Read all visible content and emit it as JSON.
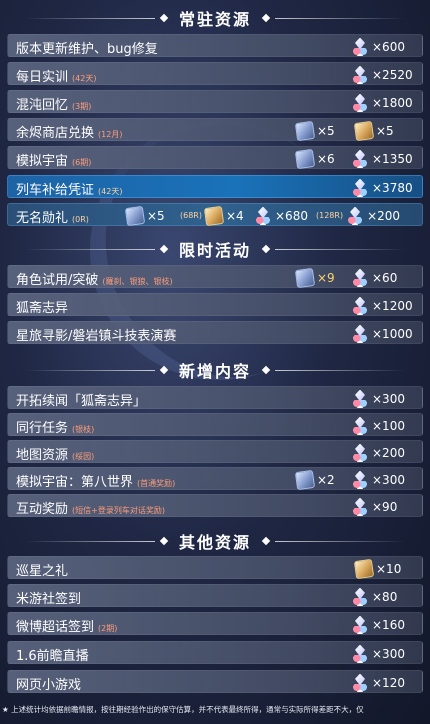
{
  "sections": {
    "permanent": "常驻资源",
    "limited": "限时活动",
    "new": "新增内容",
    "other": "其他资源"
  },
  "icons": {
    "jade": "stellar-jade-icon",
    "pass_blue": "star-rail-pass-icon",
    "pass_gold": "special-pass-icon"
  },
  "rows": {
    "r1": {
      "label": "版本更新维护、bug修复",
      "jade": "×600"
    },
    "r2": {
      "label": "每日实训",
      "sub": "(42天)",
      "jade": "×2520"
    },
    "r3": {
      "label": "混沌回忆",
      "sub": "(3期)",
      "jade": "×1800"
    },
    "r4": {
      "label": "余烬商店兑换",
      "sub": "(12月)",
      "pass_blue": "×5",
      "pass_gold": "×5"
    },
    "r5": {
      "label": "模拟宇宙",
      "sub": "(6期)",
      "pass_blue": "×6",
      "jade": "×1350"
    },
    "r6": {
      "label": "列车补给凭证",
      "sub": "(42天)",
      "jade": "×3780"
    },
    "r7": {
      "label": "无名勋礼",
      "sub": "(0R)",
      "pass_blue": "×5",
      "note1": "(68R)",
      "pass_gold": "×4",
      "jade1": "×680",
      "note2": "(128R)",
      "jade2": "×200"
    },
    "r8": {
      "label": "角色试用/突破",
      "sub": "(羅刹、银狼、银枝)",
      "pass_blue": "×9",
      "jade": "×60"
    },
    "r9": {
      "label": "狐斋志异",
      "jade": "×1200"
    },
    "r10": {
      "label": "星旅寻影/磐岩镇斗技表演赛",
      "jade": "×1000"
    },
    "r11": {
      "label": "开拓续闻「狐斋志异」",
      "jade": "×300"
    },
    "r12": {
      "label": "同行任务",
      "sub": "(银枝)",
      "jade": "×100"
    },
    "r13": {
      "label": "地图资源",
      "sub": "(绥园)",
      "jade": "×200"
    },
    "r14": {
      "label": "模拟宇宙：第八世界",
      "sub": "(首通奖励)",
      "pass_blue": "×2",
      "jade": "×300"
    },
    "r15": {
      "label": "互动奖励",
      "sub": "(短信+登录列车对话奖励)",
      "jade": "×90"
    },
    "r16": {
      "label": "巡星之礼",
      "pass_gold": "×10"
    },
    "r17": {
      "label": "米游社签到",
      "jade": "×80"
    },
    "r18": {
      "label": "微博超话签到",
      "sub": "(2期)",
      "jade": "×160"
    },
    "r19": {
      "label": "1.6前瞻直播",
      "jade": "×300"
    },
    "r20": {
      "label": "网页小游戏",
      "jade": "×120"
    }
  },
  "footer": "★ 上述统计均依据前瞻情报，按往期经验作出的保守估算，并不代表最终所得，通常与实际所得差距不大，仅"
}
